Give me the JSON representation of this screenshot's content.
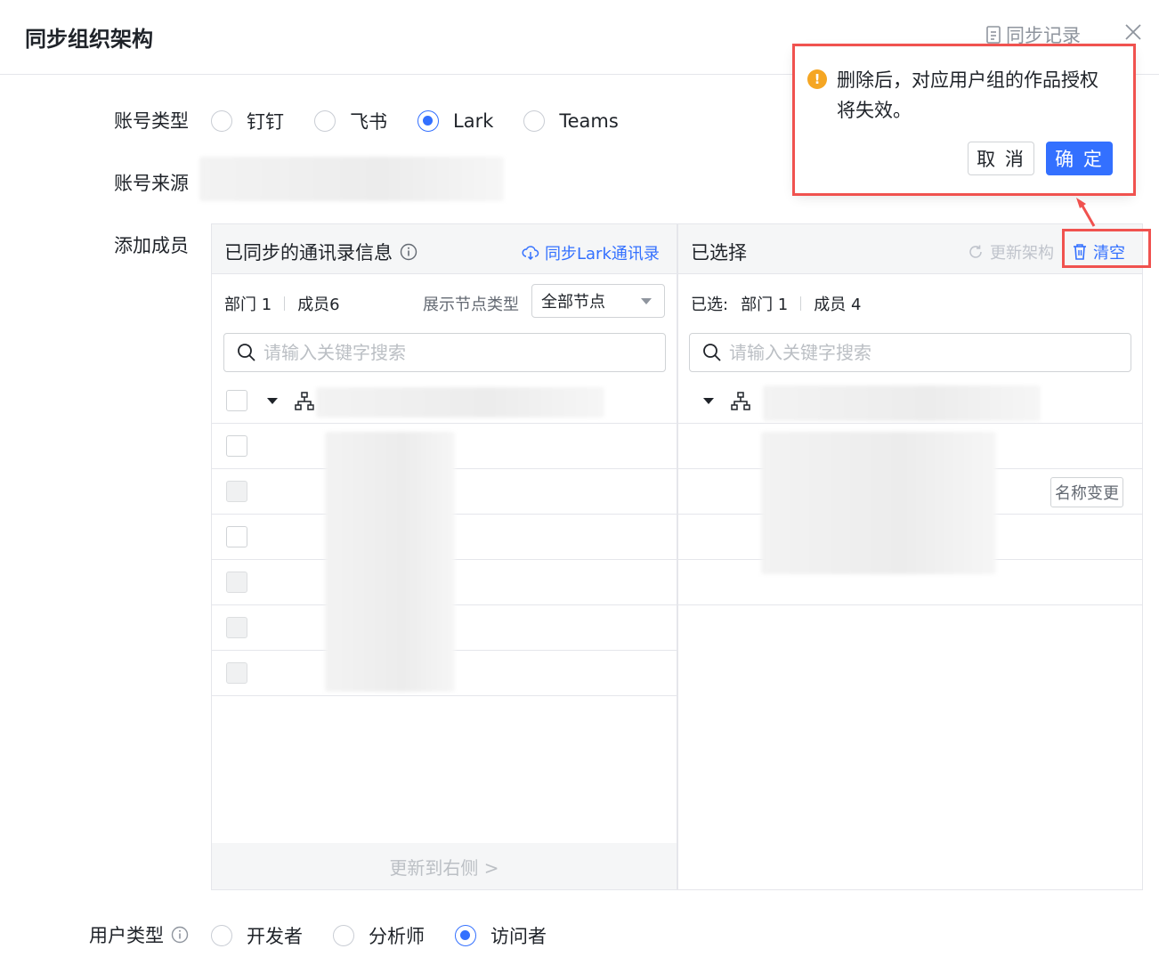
{
  "header": {
    "title": "同步组织架构",
    "sync_log_label": "同步记录"
  },
  "form": {
    "account_type": {
      "label": "账号类型",
      "options": [
        {
          "label": "钉钉",
          "selected": false
        },
        {
          "label": "飞书",
          "selected": false
        },
        {
          "label": "Lark",
          "selected": true
        },
        {
          "label": "Teams",
          "selected": false
        }
      ]
    },
    "account_source": {
      "label": "账号来源"
    },
    "add_members": {
      "label": "添加成员"
    },
    "user_type": {
      "label": "用户类型",
      "options": [
        {
          "label": "开发者",
          "selected": false
        },
        {
          "label": "分析师",
          "selected": false
        },
        {
          "label": "访问者",
          "selected": true
        }
      ]
    }
  },
  "left_panel": {
    "title": "已同步的通讯录信息",
    "sync_action": "同步Lark通讯录",
    "dept_stat": "部门 1",
    "member_stat": "成员6",
    "node_type_label": "展示节点类型",
    "node_type_value": "全部节点",
    "search_placeholder": "请输入关键字搜索",
    "update_right": "更新到右侧 >"
  },
  "right_panel": {
    "title": "已选择",
    "update_arch": "更新架构",
    "clear": "清空",
    "selected_label": "已选:",
    "dept_stat": "部门 1",
    "member_stat": "成员 4",
    "search_placeholder": "请输入关键字搜索",
    "rename_tag": "名称变更"
  },
  "popconfirm": {
    "message": "删除后，对应用户组的作品授权将失效。",
    "cancel": "取 消",
    "ok": "确 定"
  },
  "colors": {
    "primary": "#3370ff",
    "warning": "#f5a623",
    "highlight": "#f0524f"
  }
}
